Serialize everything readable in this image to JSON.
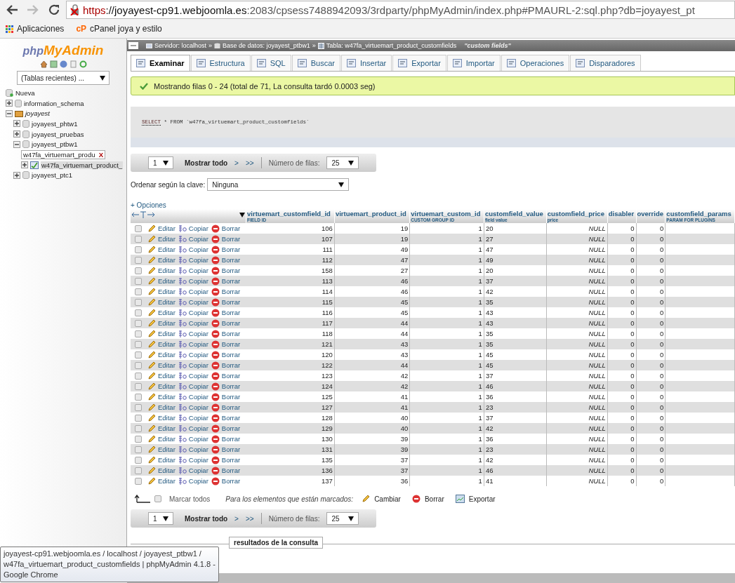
{
  "browser": {
    "url_scheme": "https",
    "url_host": "://joyayest-cp91.webjoomla.es",
    "url_rest": ":2083/cpsess7488942093/3rdparty/phpMyAdmin/index.php#PMAURL-2:sql.php?db=joyayest_pt",
    "bookmarks": [
      {
        "kind": "apps",
        "label": "Aplicaciones"
      },
      {
        "kind": "cpanel",
        "icon_text": "cP",
        "label": "cPanel joya y estilo"
      }
    ]
  },
  "sidebar": {
    "logo_prefix": "php",
    "logo_name": "MyAdmin",
    "recent_tables": "(Tablas recientes) ...",
    "tree": [
      {
        "kind": "new",
        "label": "Nueva",
        "selected": false
      },
      {
        "kind": "db",
        "label": "information_schema",
        "expanded": false,
        "selected": false
      },
      {
        "kind": "group",
        "label": "joyayest",
        "expanded": true,
        "selected": false,
        "children": [
          {
            "kind": "db",
            "label": "joyayest_phtw1",
            "expanded": false,
            "selected": false
          },
          {
            "kind": "db",
            "label": "joyayest_pruebas",
            "expanded": false,
            "selected": false
          },
          {
            "kind": "db",
            "label": "joyayest_ptbw1",
            "expanded": true,
            "selected": false,
            "children": [
              {
                "kind": "filter",
                "label": "w47fa_virtuemart_produ",
                "clear": "X"
              },
              {
                "kind": "table",
                "label": "w47fa_virtuemart_product_",
                "expanded": false,
                "selected": true
              }
            ]
          },
          {
            "kind": "db",
            "label": "joyayest_ptc1",
            "expanded": false,
            "selected": false
          }
        ]
      }
    ]
  },
  "breadcrumb": {
    "separator": "»",
    "items": [
      {
        "kind": "server",
        "label": "Servidor: localhost"
      },
      {
        "kind": "database",
        "label": "Base de datos: joyayest_ptbw1"
      },
      {
        "kind": "table",
        "label": "Tabla: w47fa_virtuemart_product_customfields"
      }
    ],
    "comment": "\"custom fields\""
  },
  "tabs": [
    {
      "label": "Examinar",
      "selected": true
    },
    {
      "label": "Estructura",
      "selected": false
    },
    {
      "label": "SQL",
      "selected": false
    },
    {
      "label": "Buscar",
      "selected": false
    },
    {
      "label": "Insertar",
      "selected": false
    },
    {
      "label": "Exportar",
      "selected": false
    },
    {
      "label": "Importar",
      "selected": false
    },
    {
      "label": "Operaciones",
      "selected": false
    },
    {
      "label": "Disparadores",
      "selected": false
    }
  ],
  "message": "Mostrando filas 0 - 24 (total de 71, La consulta tardó 0.0003 seg)",
  "sql": {
    "keyword": "SELECT",
    "rest": " * FROM `w47fa_virtuemart_product_customfields`"
  },
  "navigation": [
    {
      "page": "1",
      "show_all": "Mostrar todo",
      "next": ">",
      "last": ">>",
      "rows_label": "Número de filas:",
      "rows": "25"
    },
    {
      "page": "1",
      "show_all": "Mostrar todo",
      "next": ">",
      "last": ">>",
      "rows_label": "Número de filas:",
      "rows": "25"
    }
  ],
  "order_label": "Ordenar según la clave:",
  "order_value": "Ninguna",
  "options": "+ Opciones",
  "table": {
    "columns": [
      {
        "name": "virtuemart_customfield_id",
        "comment": "FIELD ID"
      },
      {
        "name": "virtuemart_product_id"
      },
      {
        "name": "virtuemart_custom_id",
        "comment": "CUSTOM GROUP ID"
      },
      {
        "name": "customfield_value",
        "comment": "field value"
      },
      {
        "name": "customfield_price",
        "comment": "price"
      },
      {
        "name": "disabler"
      },
      {
        "name": "override"
      },
      {
        "name": "customfield_params",
        "comment": "PARAM FOR PLUGINS"
      }
    ],
    "rows": [
      {
        "checked": false,
        "actions": [
          "Editar",
          "Copiar",
          "Borrar"
        ],
        "cells": [
          "106",
          "19",
          "1",
          "20",
          "NULL",
          "0",
          "0"
        ]
      },
      {
        "checked": false,
        "actions": [
          "Editar",
          "Copiar",
          "Borrar"
        ],
        "cells": [
          "107",
          "19",
          "1",
          "27",
          "NULL",
          "0",
          "0"
        ]
      },
      {
        "checked": false,
        "actions": [
          "Editar",
          "Copiar",
          "Borrar"
        ],
        "cells": [
          "111",
          "49",
          "1",
          "47",
          "NULL",
          "0",
          "0"
        ]
      },
      {
        "checked": false,
        "actions": [
          "Editar",
          "Copiar",
          "Borrar"
        ],
        "cells": [
          "112",
          "47",
          "1",
          "49",
          "NULL",
          "0",
          "0"
        ]
      },
      {
        "checked": false,
        "actions": [
          "Editar",
          "Copiar",
          "Borrar"
        ],
        "cells": [
          "158",
          "27",
          "1",
          "20",
          "NULL",
          "0",
          "0"
        ]
      },
      {
        "checked": false,
        "actions": [
          "Editar",
          "Copiar",
          "Borrar"
        ],
        "cells": [
          "113",
          "46",
          "1",
          "37",
          "NULL",
          "0",
          "0"
        ]
      },
      {
        "checked": false,
        "actions": [
          "Editar",
          "Copiar",
          "Borrar"
        ],
        "cells": [
          "114",
          "46",
          "1",
          "42",
          "NULL",
          "0",
          "0"
        ]
      },
      {
        "checked": false,
        "actions": [
          "Editar",
          "Copiar",
          "Borrar"
        ],
        "cells": [
          "115",
          "45",
          "1",
          "35",
          "NULL",
          "0",
          "0"
        ]
      },
      {
        "checked": false,
        "actions": [
          "Editar",
          "Copiar",
          "Borrar"
        ],
        "cells": [
          "116",
          "45",
          "1",
          "43",
          "NULL",
          "0",
          "0"
        ]
      },
      {
        "checked": false,
        "actions": [
          "Editar",
          "Copiar",
          "Borrar"
        ],
        "cells": [
          "117",
          "44",
          "1",
          "43",
          "NULL",
          "0",
          "0"
        ]
      },
      {
        "checked": false,
        "actions": [
          "Editar",
          "Copiar",
          "Borrar"
        ],
        "cells": [
          "118",
          "44",
          "1",
          "35",
          "NULL",
          "0",
          "0"
        ]
      },
      {
        "checked": false,
        "actions": [
          "Editar",
          "Copiar",
          "Borrar"
        ],
        "cells": [
          "121",
          "43",
          "1",
          "35",
          "NULL",
          "0",
          "0"
        ]
      },
      {
        "checked": false,
        "actions": [
          "Editar",
          "Copiar",
          "Borrar"
        ],
        "cells": [
          "120",
          "43",
          "1",
          "45",
          "NULL",
          "0",
          "0"
        ]
      },
      {
        "checked": false,
        "actions": [
          "Editar",
          "Copiar",
          "Borrar"
        ],
        "cells": [
          "122",
          "44",
          "1",
          "45",
          "NULL",
          "0",
          "0"
        ]
      },
      {
        "checked": false,
        "actions": [
          "Editar",
          "Copiar",
          "Borrar"
        ],
        "cells": [
          "123",
          "42",
          "1",
          "37",
          "NULL",
          "0",
          "0"
        ]
      },
      {
        "checked": false,
        "actions": [
          "Editar",
          "Copiar",
          "Borrar"
        ],
        "cells": [
          "124",
          "42",
          "1",
          "46",
          "NULL",
          "0",
          "0"
        ]
      },
      {
        "checked": false,
        "actions": [
          "Editar",
          "Copiar",
          "Borrar"
        ],
        "cells": [
          "125",
          "41",
          "1",
          "36",
          "NULL",
          "0",
          "0"
        ]
      },
      {
        "checked": false,
        "actions": [
          "Editar",
          "Copiar",
          "Borrar"
        ],
        "cells": [
          "127",
          "41",
          "1",
          "23",
          "NULL",
          "0",
          "0"
        ]
      },
      {
        "checked": false,
        "actions": [
          "Editar",
          "Copiar",
          "Borrar"
        ],
        "cells": [
          "128",
          "40",
          "1",
          "37",
          "NULL",
          "0",
          "0"
        ]
      },
      {
        "checked": false,
        "actions": [
          "Editar",
          "Copiar",
          "Borrar"
        ],
        "cells": [
          "129",
          "40",
          "1",
          "42",
          "NULL",
          "0",
          "0"
        ]
      },
      {
        "checked": false,
        "actions": [
          "Editar",
          "Copiar",
          "Borrar"
        ],
        "cells": [
          "130",
          "39",
          "1",
          "36",
          "NULL",
          "0",
          "0"
        ]
      },
      {
        "checked": false,
        "actions": [
          "Editar",
          "Copiar",
          "Borrar"
        ],
        "cells": [
          "131",
          "39",
          "1",
          "23",
          "NULL",
          "0",
          "0"
        ]
      },
      {
        "checked": false,
        "actions": [
          "Editar",
          "Copiar",
          "Borrar"
        ],
        "cells": [
          "135",
          "37",
          "1",
          "42",
          "NULL",
          "0",
          "0"
        ]
      },
      {
        "checked": false,
        "actions": [
          "Editar",
          "Copiar",
          "Borrar"
        ],
        "cells": [
          "136",
          "37",
          "1",
          "46",
          "NULL",
          "0",
          "0"
        ]
      },
      {
        "checked": false,
        "actions": [
          "Editar",
          "Copiar",
          "Borrar"
        ],
        "cells": [
          "137",
          "36",
          "1",
          "41",
          "NULL",
          "0",
          "0"
        ]
      }
    ]
  },
  "bulk": {
    "check_all": "Marcar todos",
    "checked": false,
    "with_selected": "Para los elementos que están marcados:",
    "actions": [
      "Cambiar",
      "Borrar",
      "Exportar"
    ]
  },
  "query_results_ops": "resultados de la consulta",
  "tooltip": "joyayest-cp91.webjoomla.es / localhost / joyayest_ptbw1 / w47fa_virtuemart_product_customfields | phpMyAdmin 4.1.8 - Google Chrome"
}
